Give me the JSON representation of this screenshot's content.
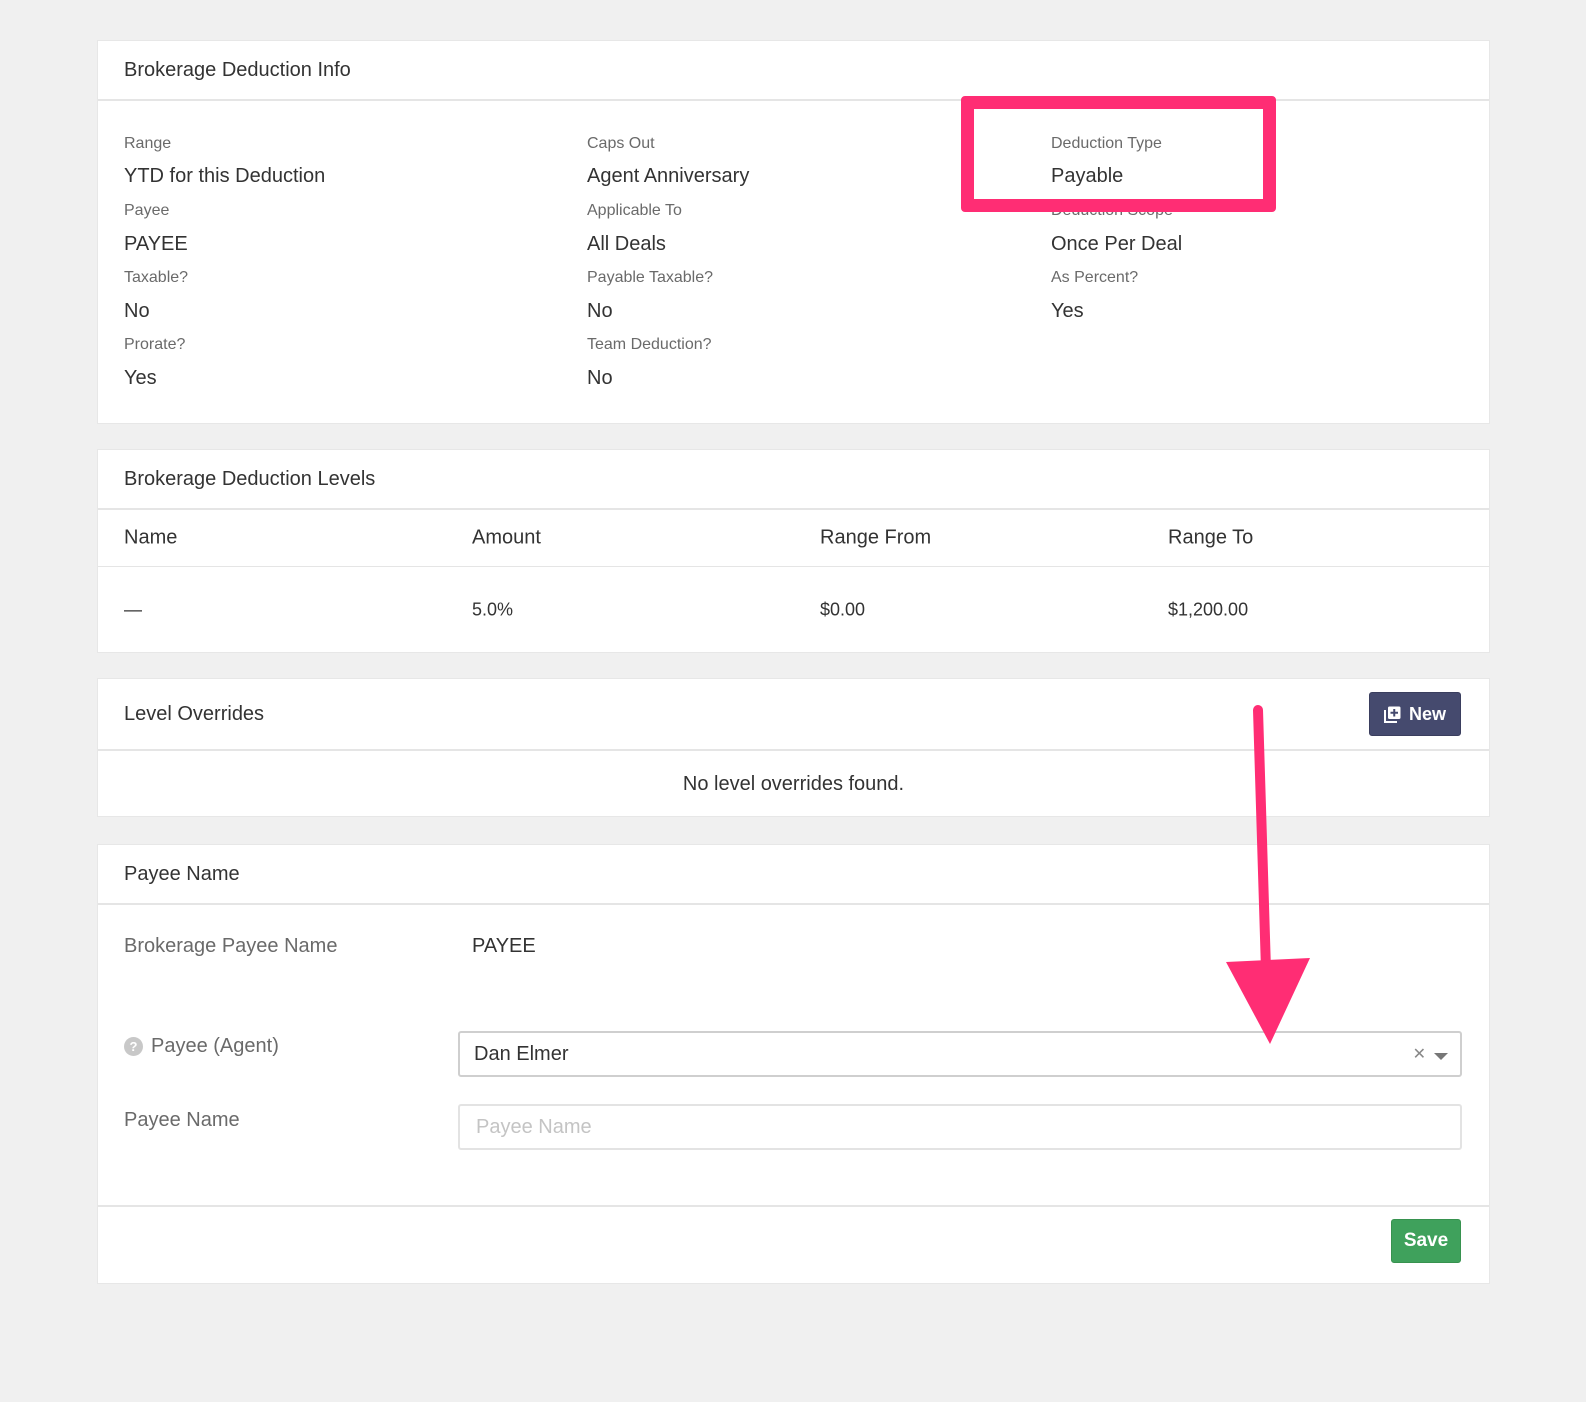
{
  "info": {
    "title": "Brokerage Deduction Info",
    "fields": {
      "range_label": "Range",
      "range_value": "YTD for this Deduction",
      "payee_label": "Payee",
      "payee_value": "PAYEE",
      "taxable_label": "Taxable?",
      "taxable_value": "No",
      "prorate_label": "Prorate?",
      "prorate_value": "Yes",
      "caps_label": "Caps Out",
      "caps_value": "Agent Anniversary",
      "applicable_label": "Applicable To",
      "applicable_value": "All Deals",
      "payable_taxable_label": "Payable Taxable?",
      "payable_taxable_value": "No",
      "team_label": "Team Deduction?",
      "team_value": "No",
      "type_label": "Deduction Type",
      "type_value": "Payable",
      "scope_label": "Deduction Scope",
      "scope_value": "Once Per Deal",
      "percent_label": "As Percent?",
      "percent_value": "Yes"
    }
  },
  "levels": {
    "title": "Brokerage Deduction Levels",
    "columns": [
      "Name",
      "Amount",
      "Range From",
      "Range To"
    ],
    "rows": [
      [
        "—",
        "5.0%",
        "$0.00",
        "$1,200.00"
      ]
    ]
  },
  "overrides": {
    "title": "Level Overrides",
    "new_label": "New",
    "empty_message": "No level overrides found."
  },
  "payee": {
    "title": "Payee Name",
    "brokerage_label": "Brokerage Payee Name",
    "brokerage_value": "PAYEE",
    "agent_label": "Payee (Agent)",
    "agent_value": "Dan Elmer",
    "name_label": "Payee Name",
    "name_placeholder": "Payee Name",
    "name_value": "",
    "save_label": "Save"
  },
  "colors": {
    "annotation": "#ff2d74",
    "new_button": "#454a6e",
    "save_button": "#3fa15c"
  }
}
